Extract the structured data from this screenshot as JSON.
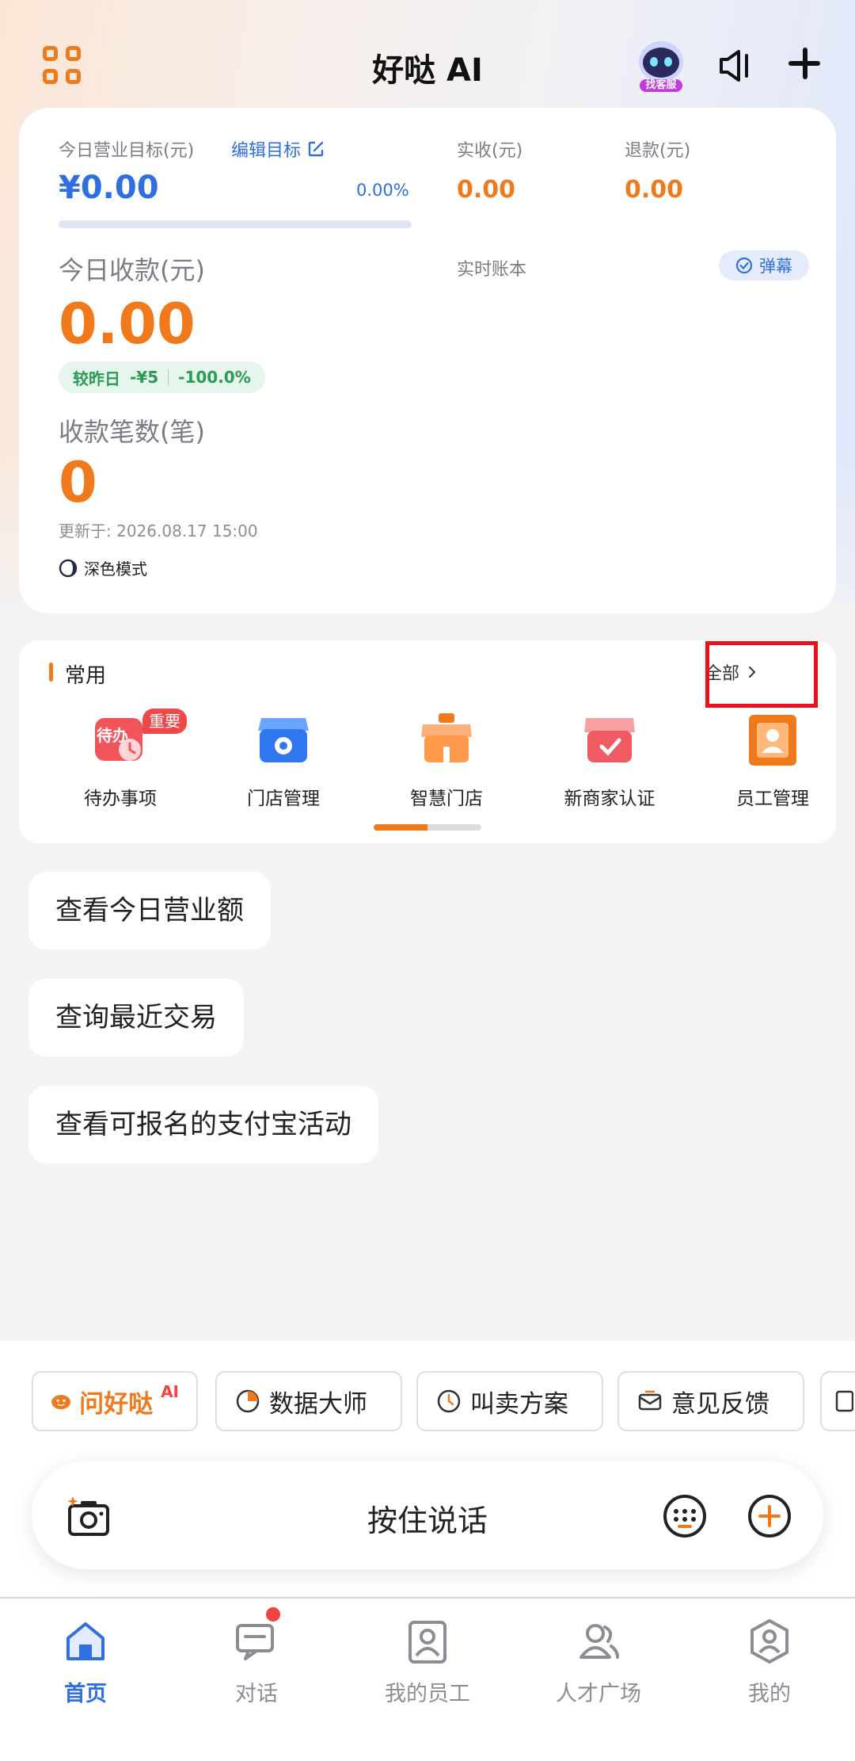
{
  "header": {
    "title": "好哒 AI",
    "robot_badge": "找客服"
  },
  "summary": {
    "target_label": "今日营业目标(元)",
    "edit_target": "编辑目标",
    "target_amount": "¥0.00",
    "target_percent": "0.00%",
    "target_progress": 0,
    "received_label": "实收(元)",
    "received_value": "0.00",
    "refund_label": "退款(元)",
    "refund_value": "0.00",
    "collect_label": "今日收款(元)",
    "ledger_label": "实时账本",
    "danmu": "弹幕",
    "collect_value": "0.00",
    "compare_label": "较昨日",
    "compare_amount": "-¥5",
    "compare_percent": "-100.0%",
    "count_label": "收款笔数(笔)",
    "count_value": "0",
    "updated": "更新于: 2026.08.17 15:00",
    "dark_mode": "深色模式"
  },
  "common": {
    "title": "常用",
    "all": "全部",
    "items": [
      {
        "label": "待办事项",
        "icon": "todo-clock-icon",
        "badge": "重要",
        "icon_text": "待办"
      },
      {
        "label": "门店管理",
        "icon": "store-manage-icon"
      },
      {
        "label": "智慧门店",
        "icon": "smart-store-icon"
      },
      {
        "label": "新商家认证",
        "icon": "merchant-verify-icon"
      },
      {
        "label": "员工管理",
        "icon": "staff-manage-icon"
      }
    ],
    "page_index": 1,
    "page_total": 2
  },
  "suggestions": [
    "查看今日营业额",
    "查询最近交易",
    "查看可报名的支付宝活动"
  ],
  "chips": [
    {
      "label": "问好哒",
      "icon": "hao-da-logo-icon",
      "tag": "AI"
    },
    {
      "label": "数据大师",
      "icon": "pie-chart-icon"
    },
    {
      "label": "叫卖方案",
      "icon": "clock-icon"
    },
    {
      "label": "意见反馈",
      "icon": "feedback-icon"
    }
  ],
  "voice": {
    "label": "按住说话"
  },
  "tabs": [
    {
      "label": "首页",
      "icon": "home-icon",
      "active": true
    },
    {
      "label": "对话",
      "icon": "chat-icon",
      "active": false,
      "dot": true
    },
    {
      "label": "我的员工",
      "icon": "employee-icon",
      "active": false
    },
    {
      "label": "人才广场",
      "icon": "talent-icon",
      "active": false
    },
    {
      "label": "我的",
      "icon": "profile-icon",
      "active": false
    }
  ],
  "colors": {
    "accent": "#2f6fe0",
    "orange": "#f07a1b",
    "green": "#2b9a57",
    "red": "#f04545"
  }
}
